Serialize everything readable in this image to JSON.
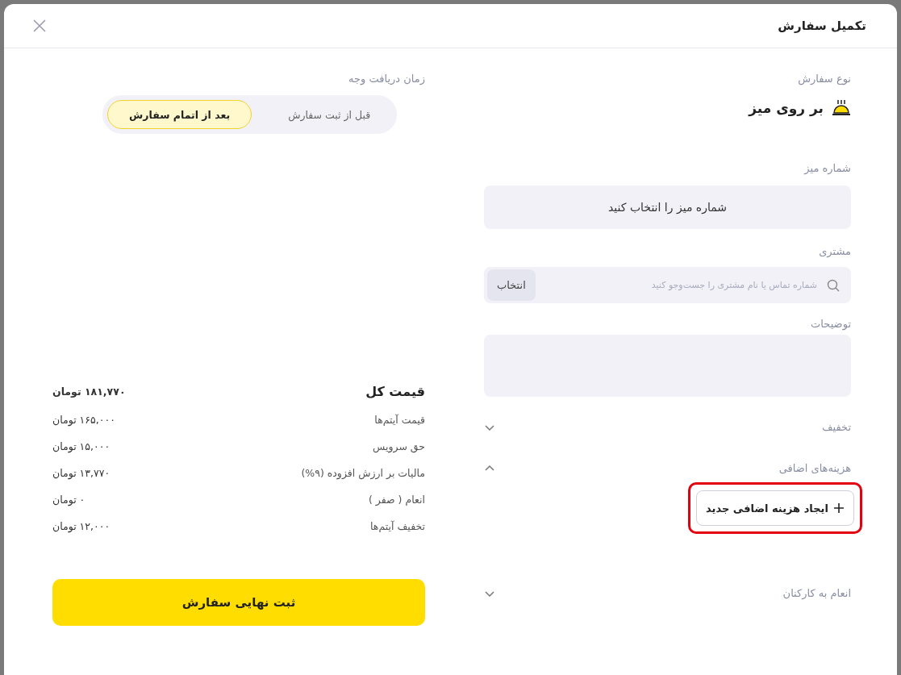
{
  "dialog": {
    "title": "تکمیل سفارش"
  },
  "order_type": {
    "label": "نوع سفارش",
    "value": "بر روی میز"
  },
  "table_number": {
    "label": "شماره میز",
    "placeholder": "شماره میز را انتخاب کنید"
  },
  "customer": {
    "label": "مشتری",
    "placeholder": "شماره تماس یا نام مشتری را جست‌وجو کنید",
    "button": "انتخاب"
  },
  "notes": {
    "label": "توضیحات"
  },
  "sections": [
    {
      "label": "تخفیف",
      "expanded": false
    },
    {
      "label": "هزینه‌های اضافی",
      "expanded": true,
      "action": "ایجاد هزینه اضافی جدید",
      "highlighted": true
    },
    {
      "label": "انعام به کارکنان",
      "expanded": false
    }
  ],
  "payment_time": {
    "label": "زمان دریافت وجه",
    "options": [
      {
        "label": "قبل از ثبت سفارش",
        "selected": false
      },
      {
        "label": "بعد از اتمام سفارش",
        "selected": true
      }
    ]
  },
  "summary": [
    {
      "kind": "total",
      "label": "قیمت کل",
      "amount": "۱۸۱,۷۷۰ تومان"
    },
    {
      "kind": "item",
      "label": "قیمت آیتم‌ها",
      "amount": "۱۶۵,۰۰۰ تومان"
    },
    {
      "kind": "item",
      "label": "حق سرویس",
      "amount": "۱۵,۰۰۰ تومان"
    },
    {
      "kind": "item",
      "label": "مالیات بر ارزش افزوده  (۹%)",
      "amount": "۱۳,۷۷۰ تومان"
    },
    {
      "kind": "item",
      "label": "انعام ( صفر )",
      "amount": "۰ تومان"
    },
    {
      "kind": "item",
      "label": "تخفیف آیتم‌ها",
      "amount": "۱۲,۰۰۰ تومان"
    }
  ],
  "submit": "ثبت نهایی سفارش"
}
